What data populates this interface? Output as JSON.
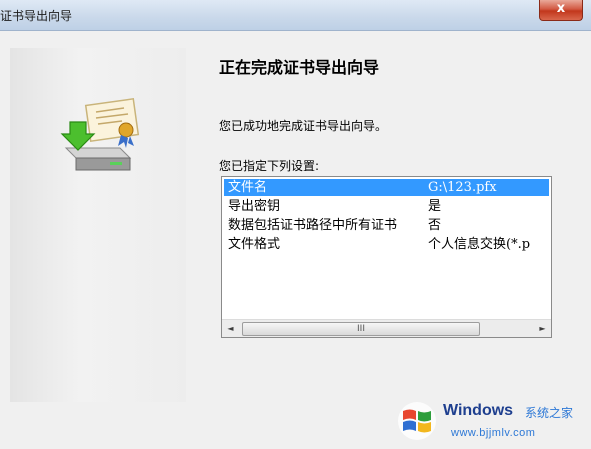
{
  "window": {
    "title": "证书导出向导",
    "close_label": "x"
  },
  "wizard": {
    "heading": "正在完成证书导出向导",
    "message": "您已成功地完成证书导出向导。",
    "settings_label": "您已指定下列设置:",
    "settings": [
      {
        "key": "文件名",
        "value": "G:\\123.pfx",
        "selected": true
      },
      {
        "key": "导出密钥",
        "value": "是",
        "selected": false
      },
      {
        "key": "数据包括证书路径中所有证书",
        "value": "否",
        "selected": false
      },
      {
        "key": "文件格式",
        "value": "个人信息交换(*.p",
        "selected": false
      }
    ],
    "scroll": {
      "left_arrow": "◄",
      "right_arrow": "►",
      "thumb_grip": "III"
    }
  },
  "watermark": {
    "brand": "Windows",
    "site": "系统之家",
    "url": "www.bjjmlv.com"
  },
  "colors": {
    "selection": "#3399ff",
    "titlebar": "#c9d8ea",
    "close": "#c2371c"
  }
}
